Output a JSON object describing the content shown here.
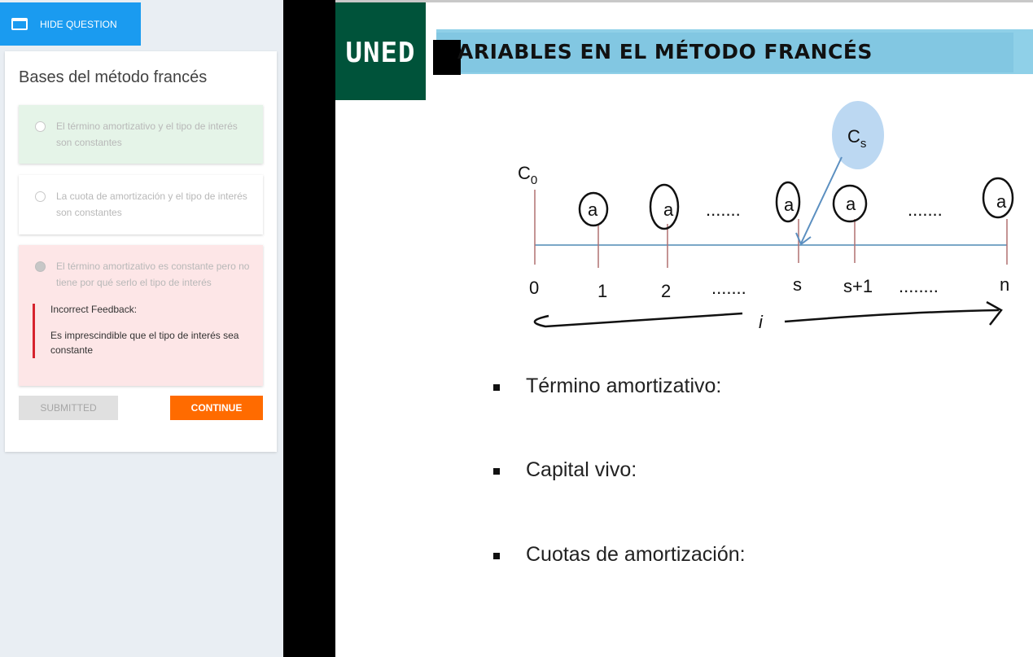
{
  "sidebar": {
    "hide_button_label": "HIDE QUESTION",
    "question": {
      "title": "Bases del método francés",
      "options": [
        {
          "text": "El término amortizativo y el tipo de interés son constantes",
          "state": "correct-highlight"
        },
        {
          "text": "La cuota de amortización y el tipo de interés son constantes",
          "state": "neutral"
        },
        {
          "text": "El término amortizativo es constante pero no tiene por qué serlo el tipo de interés",
          "state": "selected-incorrect"
        }
      ],
      "feedback": {
        "title": "Incorrect Feedback:",
        "text": "Es imprescindible que el tipo de interés sea constante"
      }
    },
    "buttons": {
      "submitted": "SUBMITTED",
      "continue": "CONTINUE"
    },
    "colors": {
      "accent_blue": "#1a9bf0",
      "continue_orange": "#ff6b00",
      "feedback_red": "#d6232e"
    }
  },
  "slide": {
    "logo": "UNED",
    "title": "ARIABLES EN EL MÉTODO FRANCÉS",
    "diagram": {
      "capital_initial": "C",
      "capital_initial_sub": "0",
      "capital_s": "C",
      "capital_s_sub": "s",
      "payment_symbol": "a",
      "dots": ".......",
      "ticks": [
        "0",
        "1",
        "2",
        ".......",
        "s",
        "s+1",
        "........",
        "n"
      ],
      "rate": "i"
    },
    "bullets": [
      "Término amortizativo:",
      "Capital vivo:",
      "Cuotas de amortización:"
    ]
  }
}
